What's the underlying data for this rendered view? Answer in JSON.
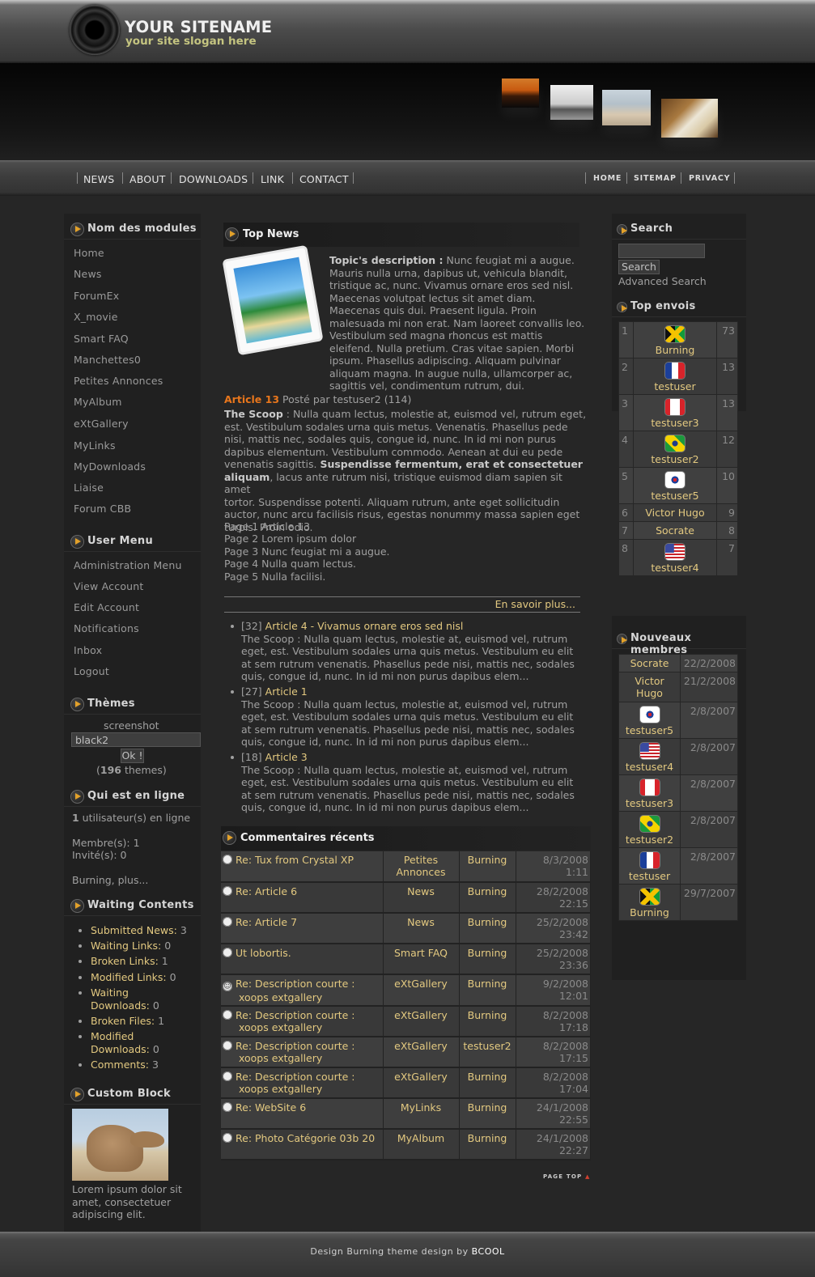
{
  "site": {
    "name": "YOUR SITENAME",
    "slogan": "your site slogan here"
  },
  "nav": {
    "left": [
      "NEWS",
      "ABOUT",
      "DOWNLOADS",
      "LINK",
      "CONTACT"
    ],
    "right": [
      "HOME",
      "SITEMAP",
      "PRIVACY"
    ]
  },
  "left": {
    "modules": {
      "title": "Nom des modules",
      "items": [
        "Home",
        "News",
        "ForumEx",
        "X_movie",
        "Smart FAQ",
        "Manchettes0",
        "Petites Annonces",
        "MyAlbum",
        "eXtGallery",
        "MyLinks",
        "MyDownloads",
        "Liaise",
        "Forum CBB"
      ]
    },
    "usermenu": {
      "title": "User Menu",
      "items": [
        "Administration Menu",
        "View Account",
        "Edit Account",
        "Notifications",
        "Inbox",
        "Logout"
      ]
    },
    "themes": {
      "title": "Thèmes",
      "screenshot": "screenshot",
      "selected": "black2",
      "ok": "Ok !",
      "count_pre": "(",
      "count": "196",
      "count_post": " themes)"
    },
    "online": {
      "title": "Qui est en ligne",
      "count": "1",
      "count_text": " utilisateur(s) en ligne",
      "members": "Membre(s): 1",
      "guests": "Invité(s): 0",
      "who": "Burning, plus..."
    },
    "waiting": {
      "title": "Waiting Contents",
      "items": [
        {
          "label": "Submitted News:",
          "value": "3"
        },
        {
          "label": "Waiting Links:",
          "value": "0"
        },
        {
          "label": "Broken Links:",
          "value": "1"
        },
        {
          "label": "Modified Links:",
          "value": "0"
        },
        {
          "label": "Waiting",
          "label2": "Downloads:",
          "value": "0"
        },
        {
          "label": "Broken Files:",
          "value": "1"
        },
        {
          "label": "Modified",
          "label2": "Downloads:",
          "value": "0"
        },
        {
          "label": "Comments:",
          "value": "3"
        }
      ]
    },
    "custom": {
      "title": "Custom Block",
      "text": "Lorem ipsum dolor sit amet, consectetuer adipiscing elit."
    }
  },
  "center": {
    "topnews": {
      "title": "Top News",
      "desc_label": "Topic's description :",
      "desc_lines": [
        " Nunc feugiat mi a augue.",
        "Mauris nulla urna, dapibus ut, vehicula blandit,",
        "tristique ac, nunc. Vivamus ornare eros sed nisl.",
        "Maecenas volutpat lectus sit amet diam.",
        "Maecenas quis dui. Praesent ligula. Proin",
        "malesuada mi non erat. Nam laoreet convallis leo.",
        "Vestibulum sed magna rhoncus est mattis",
        "eleifend. Nulla pretium. Cras vitae sapien. Morbi",
        "ipsum. Phasellus adipiscing. Aliquam pulvinar",
        "aliquam magna. In augue nulla, ullamcorper ac,",
        "sagittis vel, condimentum rutrum, dui."
      ],
      "article_title": "Article 13",
      "article_meta": " Posté par testuser2 (114)",
      "scoop_label": "The Scoop",
      "body_lines": [
        " : Nulla quam lectus, molestie at, euismod vel, rutrum eget,",
        "est. Vestibulum sodales urna quis metus. Venenatis. Phasellus pede",
        "nisi, mattis nec, sodales quis, congue id, nunc. In id mi non purus",
        "dapibus elementum. Vestibulum commodo. Aenean at dui eu pede",
        "venenatis sagittis. "
      ],
      "bold1": "Suspendisse fermentum, erat et consectetuer",
      "bold2": "aliquam",
      "body2_lines": [
        ", lacus ante rutrum nisi, tristique euismod diam sapien sit amet",
        "tortor. Suspendisse potenti. Aliquam rutrum, ante eget sollicitudin",
        "auctor, nunc arcu facilisis risus, egestas nonummy massa sapien eget",
        "turpis. Proin odio."
      ],
      "pages": [
        "Page 1 Article 13",
        "Page 2 Lorem ipsum dolor",
        "Page 3 Nunc feugiat mi a augue.",
        "Page 4 Nulla quam lectus.",
        "Page 5 Nulla facilisi."
      ],
      "more": "En savoir plus...",
      "list": [
        {
          "num": "[32]",
          "title": "Article 4 - Vivamus ornare eros sed nisl"
        },
        {
          "num": "[27]",
          "title": "Article 1"
        },
        {
          "num": "[18]",
          "title": "Article 3"
        }
      ],
      "list_lines": [
        "The Scoop : Nulla quam lectus, molestie at, euismod vel, rutrum",
        "eget, est. Vestibulum sodales urna quis metus. Vestibulum eu elit",
        "at sem rutrum venenatis. Phasellus pede nisi, mattis nec, sodales",
        "quis, congue id, nunc. In id mi non purus dapibus elem..."
      ]
    },
    "comments": {
      "title": "Commentaires récents",
      "rows": [
        {
          "t1": "Re: Tux from Crystal XP",
          "t2": "",
          "mod1": "Petites",
          "mod2": "Annonces",
          "user": "Burning",
          "date": "8/3/2008",
          "time": "1:11",
          "icon": "radio-icon"
        },
        {
          "t1": "Re: Article 6",
          "t2": "",
          "mod1": "News",
          "mod2": "",
          "user": "Burning",
          "date": "28/2/2008",
          "time": "22:15",
          "icon": "radio-icon"
        },
        {
          "t1": "Re: Article 7",
          "t2": "",
          "mod1": "News",
          "mod2": "",
          "user": "Burning",
          "date": "25/2/2008",
          "time": "23:42",
          "icon": "radio-icon"
        },
        {
          "t1": "Ut lobortis.",
          "t2": "",
          "mod1": "Smart FAQ",
          "mod2": "",
          "user": "Burning",
          "date": "25/2/2008",
          "time": "23:36",
          "icon": "radio-icon"
        },
        {
          "t1": "Re: Description courte :",
          "t2": "xoops extgallery",
          "mod1": "eXtGallery",
          "mod2": "",
          "user": "Burning",
          "date": "9/2/2008",
          "time": "12:01",
          "icon": "smiley-icon"
        },
        {
          "t1": "Re: Description courte :",
          "t2": "xoops extgallery",
          "mod1": "eXtGallery",
          "mod2": "",
          "user": "Burning",
          "date": "8/2/2008",
          "time": "17:18",
          "icon": "radio-icon"
        },
        {
          "t1": "Re: Description courte :",
          "t2": "xoops extgallery",
          "mod1": "eXtGallery",
          "mod2": "",
          "user": "testuser2",
          "date": "8/2/2008",
          "time": "17:15",
          "icon": "radio-icon"
        },
        {
          "t1": "Re: Description courte :",
          "t2": "xoops extgallery",
          "mod1": "eXtGallery",
          "mod2": "",
          "user": "Burning",
          "date": "8/2/2008",
          "time": "17:04",
          "icon": "radio-icon"
        },
        {
          "t1": "Re: WebSite 6",
          "t2": "",
          "mod1": "MyLinks",
          "mod2": "",
          "user": "Burning",
          "date": "24/1/2008",
          "time": "22:55",
          "icon": "radio-icon"
        },
        {
          "t1": "Re: Photo Catégorie 03b 20",
          "t2": "",
          "mod1": "MyAlbum",
          "mod2": "",
          "user": "Burning",
          "date": "24/1/2008",
          "time": "22:27",
          "icon": "radio-icon"
        }
      ]
    },
    "pagetop": "PAGE TOP"
  },
  "right": {
    "search": {
      "title": "Search",
      "button": "Search",
      "advanced": "Advanced Search"
    },
    "top": {
      "title": "Top envois",
      "rows": [
        {
          "rank": "1",
          "name": "Burning",
          "count": "73",
          "flag": "jamaica"
        },
        {
          "rank": "2",
          "name": "testuser",
          "count": "13",
          "flag": "france"
        },
        {
          "rank": "3",
          "name": "testuser3",
          "count": "13",
          "flag": "canada"
        },
        {
          "rank": "4",
          "name": "testuser2",
          "count": "12",
          "flag": "brazil"
        },
        {
          "rank": "5",
          "name": "testuser5",
          "count": "10",
          "flag": "korea"
        },
        {
          "rank": "6",
          "name": "Victor Hugo",
          "count": "9",
          "flag": ""
        },
        {
          "rank": "7",
          "name": "Socrate",
          "count": "8",
          "flag": ""
        },
        {
          "rank": "8",
          "name": "testuser4",
          "count": "7",
          "flag": "usa"
        }
      ]
    },
    "newmembers": {
      "title": "Nouveaux membres",
      "rows": [
        {
          "name": "Socrate",
          "name2": "",
          "date": "22/2/2008",
          "flag": ""
        },
        {
          "name": "Victor",
          "name2": "Hugo",
          "date": "21/2/2008",
          "flag": ""
        },
        {
          "name": "testuser5",
          "name2": "",
          "date": "2/8/2007",
          "flag": "korea"
        },
        {
          "name": "testuser4",
          "name2": "",
          "date": "2/8/2007",
          "flag": "usa"
        },
        {
          "name": "testuser3",
          "name2": "",
          "date": "2/8/2007",
          "flag": "canada"
        },
        {
          "name": "testuser2",
          "name2": "",
          "date": "2/8/2007",
          "flag": "brazil"
        },
        {
          "name": "testuser",
          "name2": "",
          "date": "2/8/2007",
          "flag": "france"
        },
        {
          "name": "Burning",
          "name2": "",
          "date": "29/7/2007",
          "flag": "jamaica"
        }
      ]
    }
  },
  "footer": {
    "text": "Design Burning theme design by ",
    "author": "BCOOL"
  }
}
